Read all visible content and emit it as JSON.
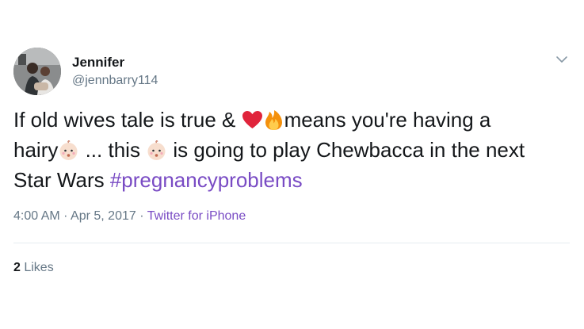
{
  "user": {
    "display_name": "Jennifer",
    "handle": "@jennbarry114"
  },
  "tweet": {
    "line1_a": "If old wives tale is true & ",
    "line1_b": "means you're having a",
    "line2_a": "hairy",
    "line2_b": " ... this ",
    "line2_c": " is going to play Chewbacca in the next",
    "line3_a": "Star Wars ",
    "hashtag": "#pregnancyproblems",
    "emojis": {
      "heart": "red-heart-icon",
      "fire": "fire-icon",
      "baby": "baby-face-icon"
    }
  },
  "meta": {
    "time": "4:00 AM",
    "sep1": " · ",
    "date": "Apr 5, 2017",
    "sep2": " · ",
    "source": "Twitter for iPhone"
  },
  "stats": {
    "likes_count": "2",
    "likes_label": " Likes"
  },
  "colors": {
    "accent": "#794bc4",
    "muted": "#657786",
    "text": "#14171a",
    "heart": "#e0243b",
    "divider": "#e6ecf0"
  }
}
